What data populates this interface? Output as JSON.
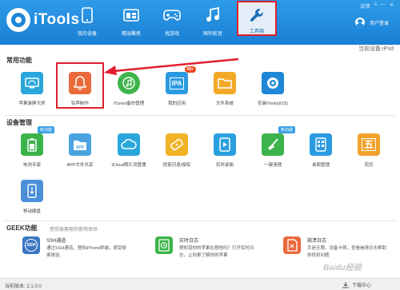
{
  "app": {
    "name": "iTools"
  },
  "topbar": {
    "feedback": "反馈",
    "menu": "≡",
    "minimize": "—",
    "close": "✕",
    "user_login": "用户登录"
  },
  "nav": [
    {
      "label": "我的设备",
      "icon": "phone-icon"
    },
    {
      "label": "精品聚焦",
      "icon": "store-icon"
    },
    {
      "label": "找游戏",
      "icon": "gamepad-icon"
    },
    {
      "label": "图铃影音",
      "icon": "music-icon"
    },
    {
      "label": "工具箱",
      "icon": "wrench-icon",
      "active": true
    }
  ],
  "current_device": "当前设备:iPod",
  "sections": {
    "common": {
      "title": "常用功能",
      "tools": [
        {
          "label": "苹果录屏大师",
          "icon": "screen-record-icon",
          "color": "#29a7dc"
        },
        {
          "label": "铃声制作",
          "icon": "bell-icon",
          "color": "#ea6a3c"
        },
        {
          "label": "iTunes备份管理",
          "icon": "music-backup-icon",
          "color": "#3fb44a"
        },
        {
          "label": "我的应用",
          "icon": "ipa-icon",
          "color": "#2a9be2",
          "badge": "99+"
        },
        {
          "label": "文件系统",
          "icon": "folder-icon",
          "color": "#f3a928"
        },
        {
          "label": "安装iTools(iOS)",
          "icon": "itools-ios-icon",
          "color": "#1e88d6"
        }
      ]
    },
    "device": {
      "title": "设备管理",
      "tools": [
        {
          "label": "电池专家",
          "icon": "battery-icon",
          "color": "#3cb44b",
          "badge": "新功能"
        },
        {
          "label": "APP文件共享",
          "icon": "app-share-icon",
          "color": "#4aa3de"
        },
        {
          "label": "iCloud照片流管理",
          "icon": "cloud-icon",
          "color": "#29a7dc"
        },
        {
          "label": "修复闪退/授权",
          "icon": "fix-icon",
          "color": "#f0b326"
        },
        {
          "label": "实时桌面",
          "icon": "play-icon",
          "color": "#2aa0e0"
        },
        {
          "label": "一键清理",
          "icon": "broom-icon",
          "color": "#3cb44b",
          "badge": "新功能"
        },
        {
          "label": "桌面管理",
          "icon": "desktop-grid-icon",
          "color": "#2a9be2"
        },
        {
          "label": "农历",
          "icon": "calendar-icon",
          "color": "#f0a22a"
        },
        {
          "label": "移动硬盘",
          "icon": "usb-drive-icon",
          "color": "#4a8fd8"
        }
      ]
    },
    "geek": {
      "title": "GEEK功能",
      "subtitle": "感受极客般的使用体验",
      "items": [
        {
          "title": "SSH通道",
          "desc": "通过SSH通道，登陆iPhone终端，感受极客体验",
          "icon": "ssh-icon",
          "color": "#3b78c3"
        },
        {
          "title": "实时日志",
          "desc": "想知道你的苹果在想啥吗？打开实时日志，让你更了解你的苹果",
          "icon": "log-icon",
          "color": "#3cb44b"
        },
        {
          "title": "崩溃日志",
          "desc": "手迷无限，设备卡顿，查看崩溃日志帮助你找到问题",
          "icon": "crash-log-icon",
          "color": "#ea6a3c"
        }
      ]
    }
  },
  "status": {
    "version": "当前版本: 2.1.0.0",
    "download": "下载中心"
  },
  "watermark": "Baidu经验"
}
